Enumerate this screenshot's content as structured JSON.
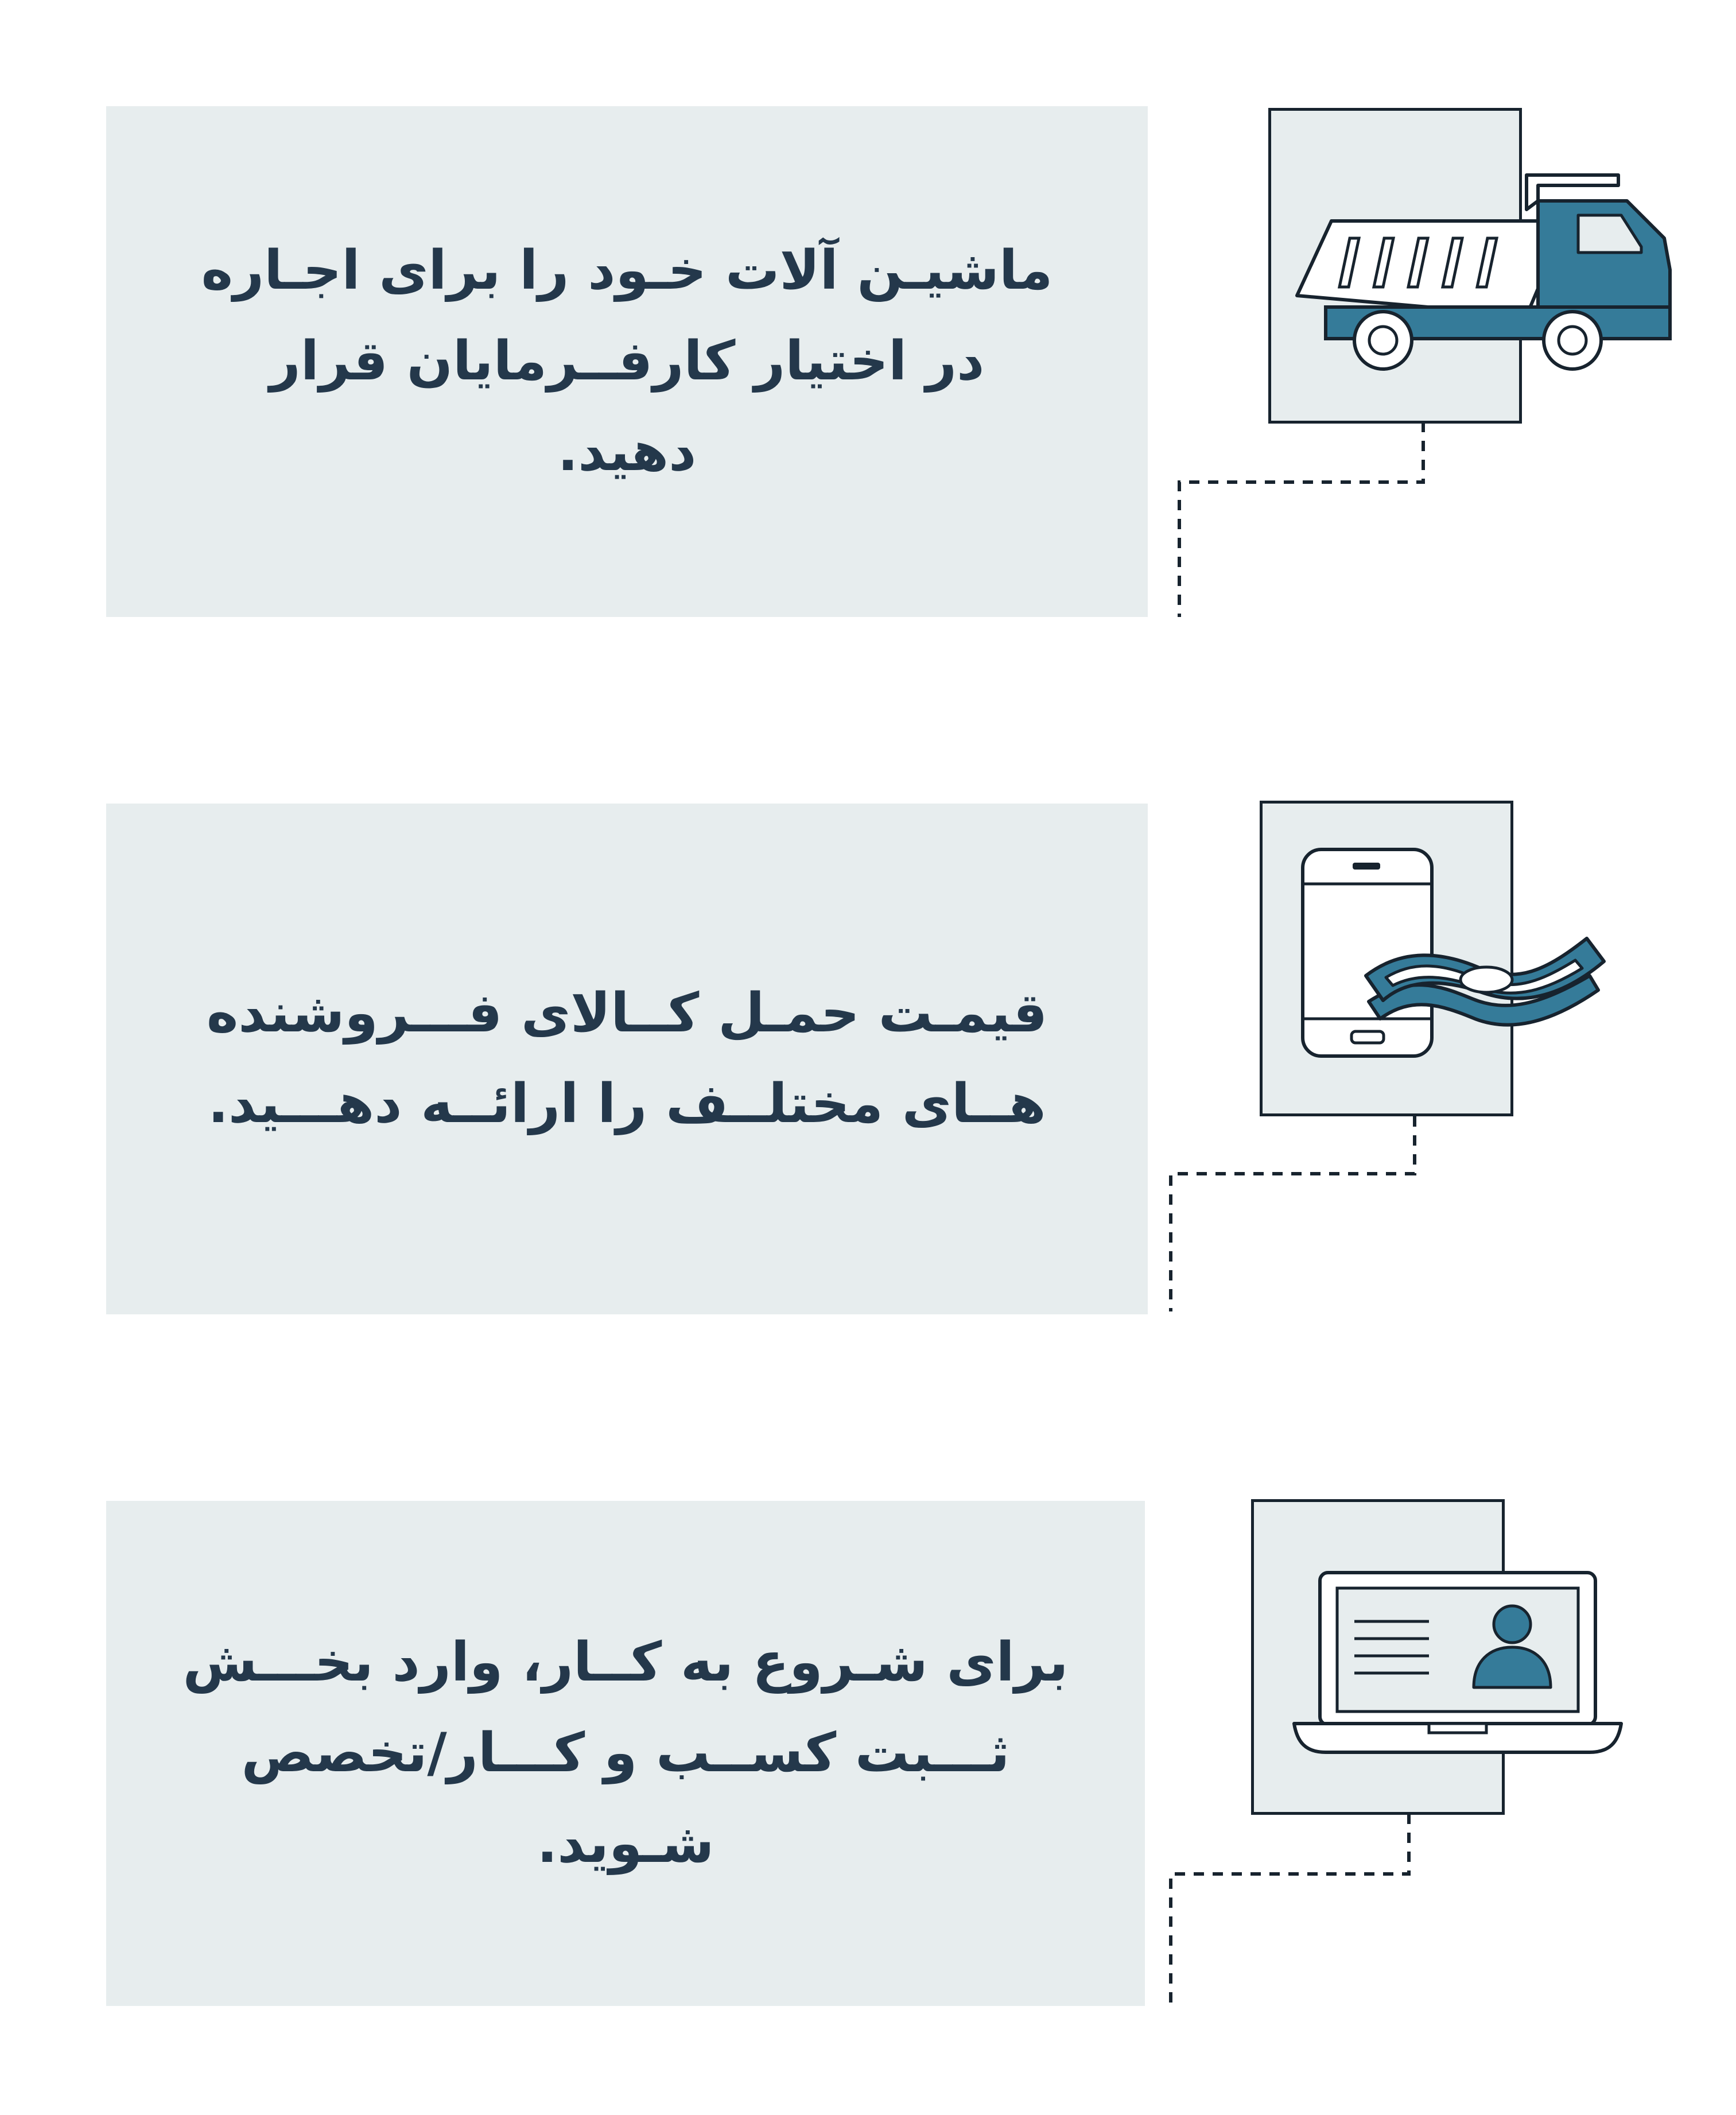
{
  "colors": {
    "panel_background": "#e7edee",
    "text": "#24384b",
    "outline": "#17232e",
    "accent": "#357b99"
  },
  "steps": [
    {
      "text": "ماشیـن آلات خـود را برای اجـاره در اختیار کارفــرمایان قرار دهید.",
      "icon": "dump-truck-icon"
    },
    {
      "text": "قیمـت حمـل کــالای فـــروشنده هــای مختلــف را ارائــه دهـــید.",
      "icon": "phone-money-icon"
    },
    {
      "text": "برای شـروع به کــار، وارد بخـــش ثـــبت کســب و کـــار/تخصص شـوید.",
      "icon": "laptop-profile-icon"
    }
  ]
}
